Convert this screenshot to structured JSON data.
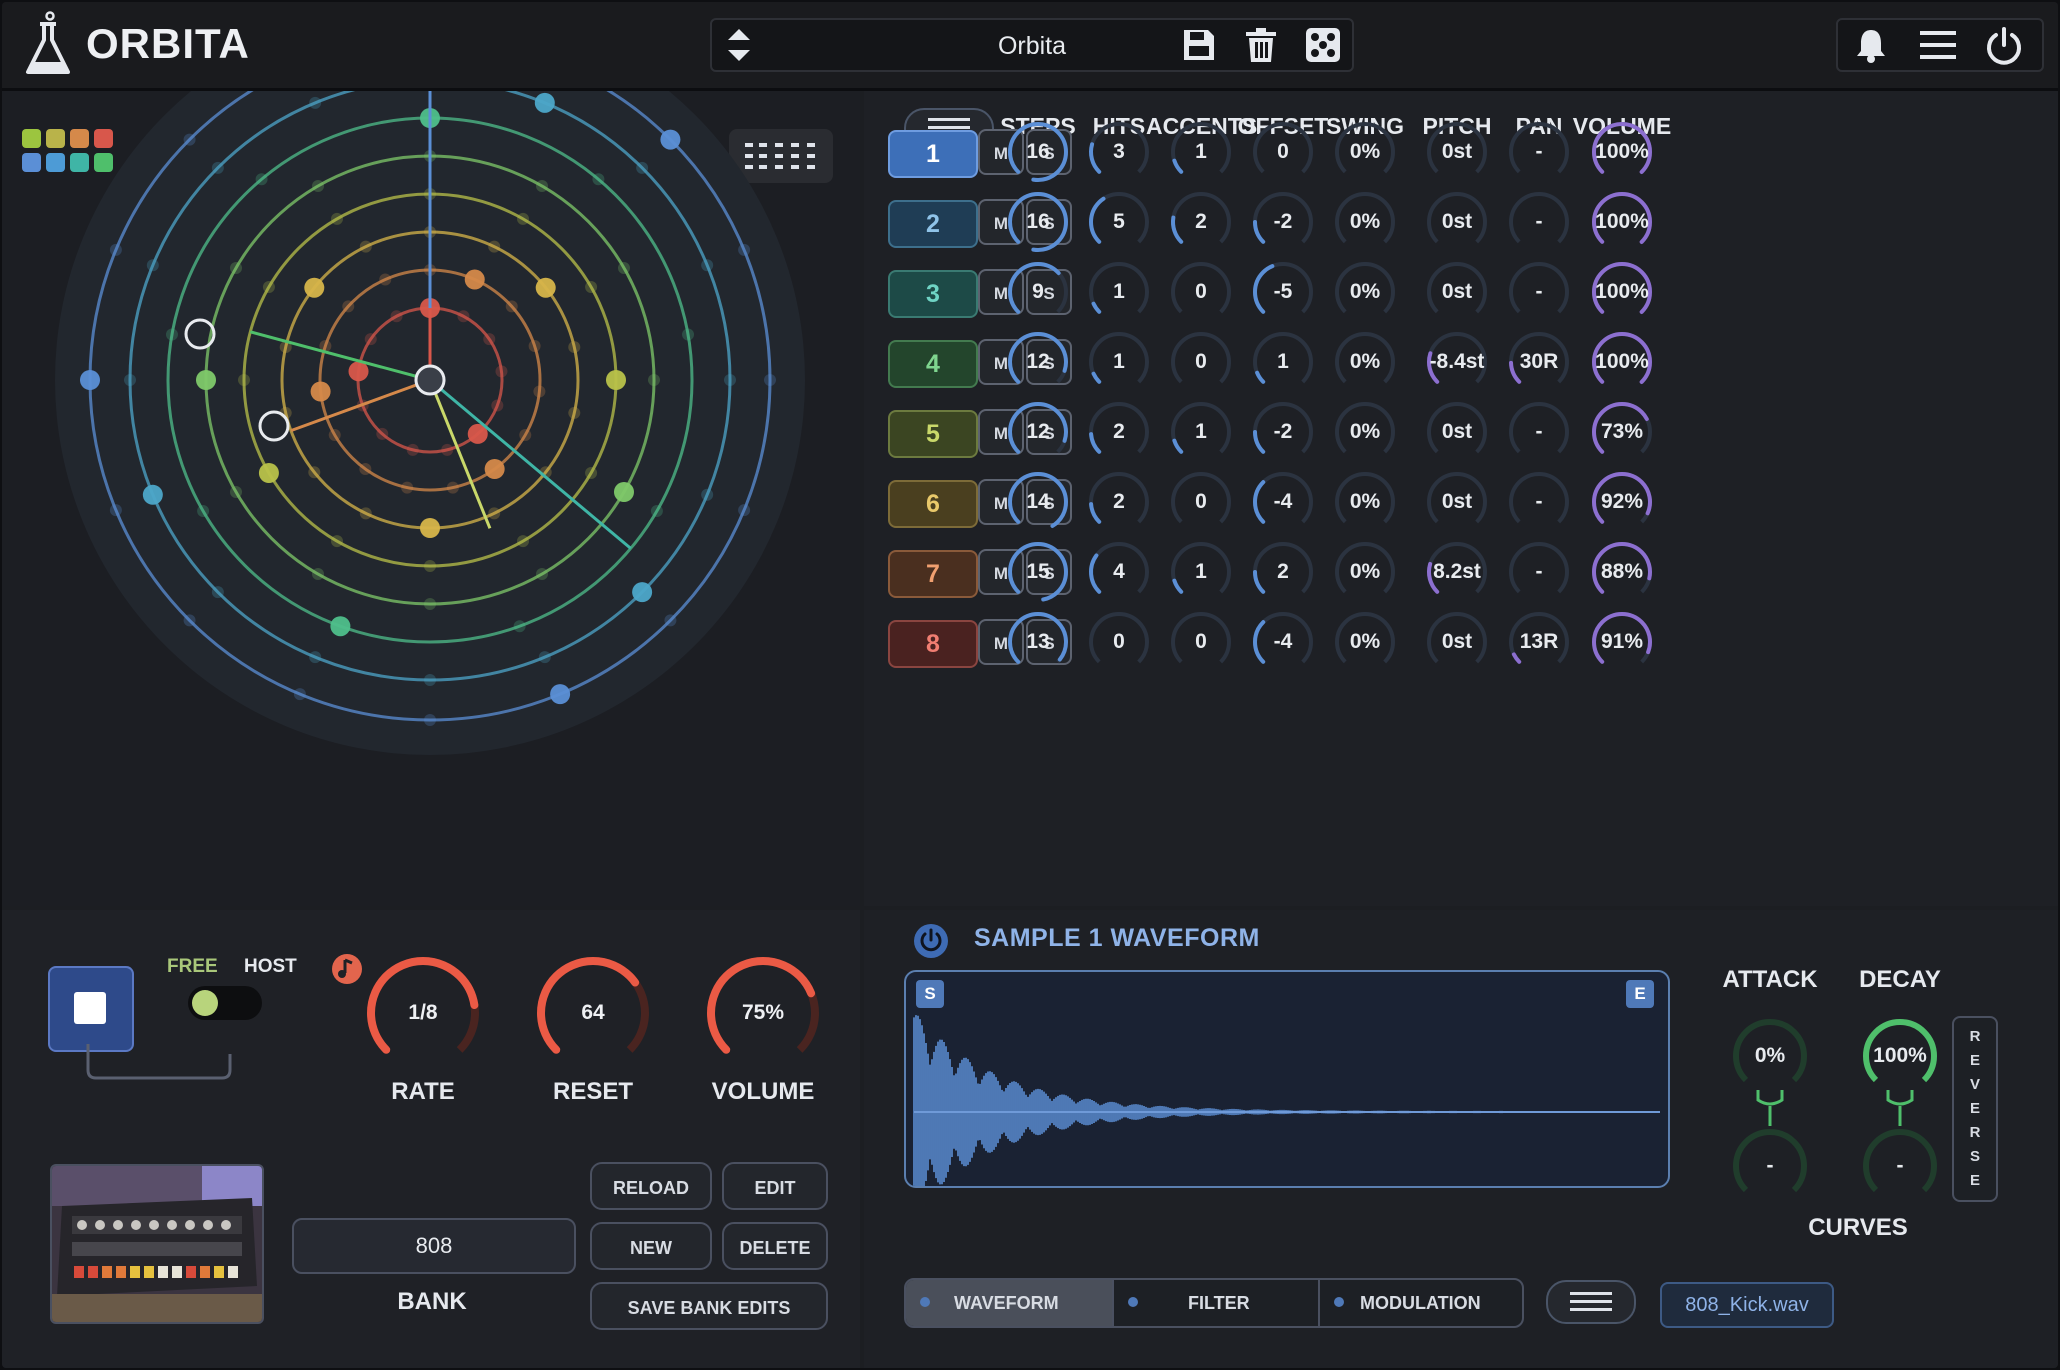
{
  "app": {
    "title": "ORBITA"
  },
  "preset": {
    "name": "Orbita"
  },
  "header_icons": [
    "flask-icon",
    "updown-arrows-icon",
    "save-icon",
    "trash-icon",
    "dice-icon",
    "bell-icon",
    "hamburger-menu-icon",
    "power-icon"
  ],
  "track_colors": [
    "#5b8fd6",
    "#3fb5a6",
    "#4fbf6b",
    "#9cc53f",
    "#d7b54a",
    "#e08b45",
    "#e0634f"
  ],
  "columns": [
    "STEPS",
    "HITS",
    "ACCENTS",
    "OFFSET",
    "SWING",
    "PITCH",
    "PAN",
    "VOLUME"
  ],
  "tracks": [
    {
      "num": "1",
      "mute": "M",
      "solo": "S",
      "steps": "16",
      "hits": "3",
      "accents": "1",
      "offset": "0",
      "swing": "0%",
      "pitch": "0st",
      "pan": "-",
      "volume": "100%"
    },
    {
      "num": "2",
      "mute": "M",
      "solo": "S",
      "steps": "16",
      "hits": "5",
      "accents": "2",
      "offset": "-2",
      "swing": "0%",
      "pitch": "0st",
      "pan": "-",
      "volume": "100%"
    },
    {
      "num": "3",
      "mute": "M",
      "solo": "S",
      "steps": "9",
      "hits": "1",
      "accents": "0",
      "offset": "-5",
      "swing": "0%",
      "pitch": "0st",
      "pan": "-",
      "volume": "100%"
    },
    {
      "num": "4",
      "mute": "M",
      "solo": "S",
      "steps": "12",
      "hits": "1",
      "accents": "0",
      "offset": "1",
      "swing": "0%",
      "pitch": "-8.4st",
      "pan": "30R",
      "volume": "100%"
    },
    {
      "num": "5",
      "mute": "M",
      "solo": "S",
      "steps": "12",
      "hits": "2",
      "accents": "1",
      "offset": "-2",
      "swing": "0%",
      "pitch": "0st",
      "pan": "-",
      "volume": "73%"
    },
    {
      "num": "6",
      "mute": "M",
      "solo": "S",
      "steps": "14",
      "hits": "2",
      "accents": "0",
      "offset": "-4",
      "swing": "0%",
      "pitch": "0st",
      "pan": "-",
      "volume": "92%"
    },
    {
      "num": "7",
      "mute": "M",
      "solo": "S",
      "steps": "15",
      "hits": "4",
      "accents": "1",
      "offset": "2",
      "swing": "0%",
      "pitch": "8.2st",
      "pan": "-",
      "volume": "88%"
    },
    {
      "num": "8",
      "mute": "M",
      "solo": "S",
      "steps": "13",
      "hits": "0",
      "accents": "0",
      "offset": "-4",
      "swing": "0%",
      "pitch": "0st",
      "pan": "13R",
      "volume": "91%"
    }
  ],
  "transport": {
    "free_label": "FREE",
    "host_label": "HOST",
    "rate": {
      "value": "1/8",
      "label": "RATE",
      "level": 0.8
    },
    "reset": {
      "value": "64",
      "label": "RESET",
      "level": 0.7
    },
    "volume": {
      "value": "75%",
      "label": "VOLUME",
      "level": 0.75
    }
  },
  "bank": {
    "name": "808",
    "label": "BANK",
    "reload": "RELOAD",
    "edit": "EDIT",
    "new": "NEW",
    "delete": "DELETE",
    "save": "SAVE BANK EDITS"
  },
  "sample": {
    "title": "SAMPLE 1 WAVEFORM",
    "start_marker": "S",
    "end_marker": "E",
    "attack_label": "ATTACK",
    "attack_value": "0%",
    "decay_label": "DECAY",
    "decay_value": "100%",
    "attack_curve": "-",
    "decay_curve": "-",
    "curves_label": "CURVES",
    "reverse_label": [
      "R",
      "E",
      "V",
      "E",
      "R",
      "S",
      "E"
    ],
    "tabs": [
      "WAVEFORM",
      "FILTER",
      "MODULATION"
    ],
    "file": "808_Kick.wav"
  }
}
